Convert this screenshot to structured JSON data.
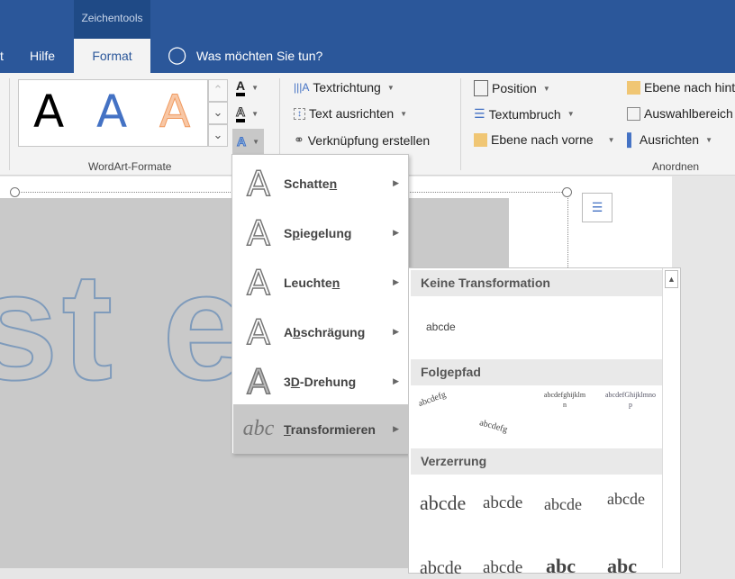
{
  "titlebar": {
    "context_tab": "Zeichentools"
  },
  "tabs": [
    {
      "label": "t"
    },
    {
      "label": "Hilfe"
    },
    {
      "label": "Format",
      "active": true
    }
  ],
  "tell_me": "Was möchten Sie tun?",
  "ribbon": {
    "wordart_group": "WordArt-Formate",
    "wordart_styles": [
      {
        "glyph": "A",
        "color": "#000000"
      },
      {
        "glyph": "A",
        "color": "#4472c4"
      },
      {
        "glyph": "A",
        "color": "#f4b183"
      }
    ],
    "text_buttons": [
      "Textrichtung",
      "Text ausrichten",
      "Verknüpfung erstellen"
    ],
    "arrange_col1": [
      "Position",
      "Textumbruch",
      "Ebene nach vorne"
    ],
    "arrange_col2": [
      "Ebene nach hinten",
      "Auswahlbereich",
      "Ausrichten"
    ],
    "arrange_group": "Anordnen"
  },
  "document": {
    "text": "st e"
  },
  "menu": {
    "items": [
      {
        "pre": "Schatte",
        "key": "n",
        "post": ""
      },
      {
        "pre": "S",
        "key": "p",
        "post": "iegelung"
      },
      {
        "pre": "Leuchte",
        "key": "n",
        "post": ""
      },
      {
        "pre": "A",
        "key": "b",
        "post": "schrägung"
      },
      {
        "pre": "3",
        "key": "D",
        "post": "-Drehung"
      },
      {
        "pre": "",
        "key": "T",
        "post": "ransformieren",
        "icon": "abc"
      }
    ]
  },
  "submenu": {
    "sections": [
      "Keine Transformation",
      "Folgepfad",
      "Verzerrung"
    ],
    "no_transform_sample": "abcde",
    "path_samples": [
      "abcdefg",
      "abcdefg",
      "abcdefghijklmn",
      "abcdefGhijklmnop"
    ],
    "warp_samples": [
      "abcde",
      "abcde",
      "abcde",
      "abcde",
      "abcde",
      "abcde",
      "abc",
      "abc"
    ]
  },
  "colors": {
    "accent": "#2b579a"
  }
}
